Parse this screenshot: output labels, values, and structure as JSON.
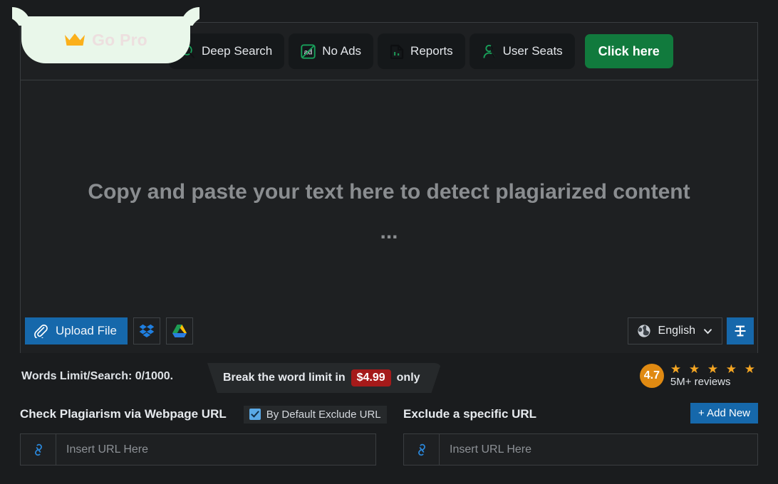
{
  "tabbar": {
    "go_pro": {
      "label": "Go Pro",
      "icon": "crown-icon",
      "bg": "#e9f7ea",
      "text_color": "#eddfdf"
    },
    "tabs": [
      {
        "label": "Deep Search",
        "icon": "search-icon"
      },
      {
        "label": "No Ads",
        "icon": "no-ads-icon"
      },
      {
        "label": "Reports",
        "icon": "report-file-icon"
      },
      {
        "label": "User Seats",
        "icon": "user-icon"
      }
    ],
    "cta": {
      "label": "Click here",
      "color": "#117a3d"
    }
  },
  "editor": {
    "placeholder": "Copy and paste your text here to detect plagiarized content ...",
    "upload": {
      "label": "Upload File",
      "icon": "paperclip-icon",
      "color": "#1668ab"
    },
    "cloud_buttons": [
      {
        "name": "dropbox-button",
        "icon": "dropbox-icon"
      },
      {
        "name": "google-drive-button",
        "icon": "google-drive-icon"
      }
    ],
    "language": {
      "value": "English",
      "icon": "globe-icon",
      "chevron": "chevron-down-icon"
    },
    "text_case": {
      "icon": "text-format-icon",
      "color": "#1668ab"
    }
  },
  "limits": {
    "words_text": "Words Limit/Search: 0/1000.",
    "promo_prefix": "Break the word limit in",
    "promo_price": "$4.99",
    "promo_suffix": "only",
    "price_color": "#a51a1a"
  },
  "rating": {
    "score": "4.7",
    "stars": "★ ★ ★ ★ ★",
    "reviews": "5M+ reviews",
    "badge_color": "#e08a12",
    "star_color": "#f5a623"
  },
  "url_sections": [
    {
      "title": "Check Plagiarism via Webpage URL",
      "checkbox_label": "By Default Exclude URL",
      "checkbox_checked": true,
      "input_placeholder": "Insert URL Here",
      "input_value": "",
      "icon": "link-icon"
    },
    {
      "title": "Exclude a specific URL",
      "add_new_label": "+ Add New",
      "input_placeholder": "Insert URL Here",
      "input_value": "",
      "icon": "link-icon"
    }
  ]
}
